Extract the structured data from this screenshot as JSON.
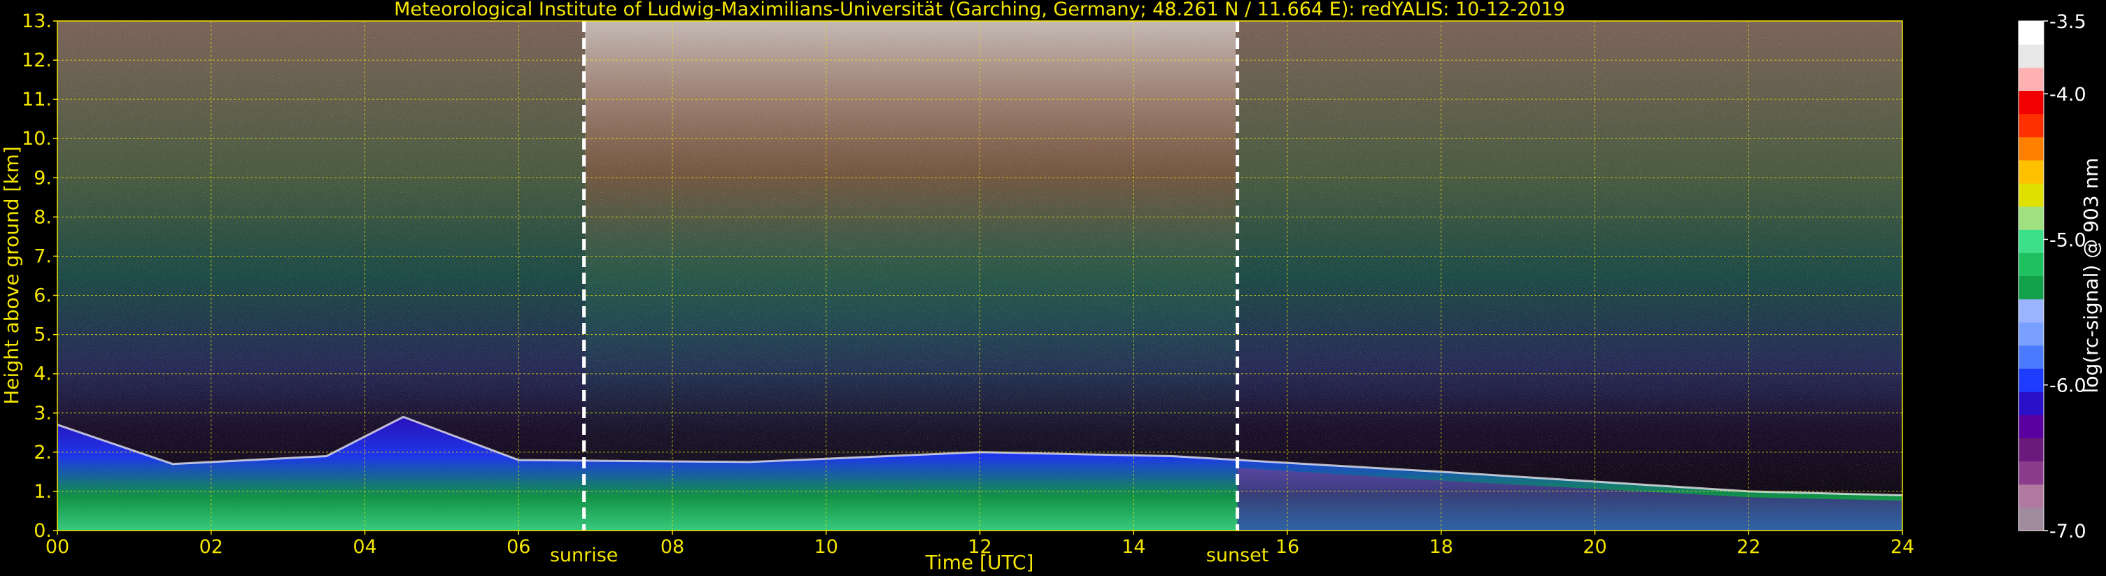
{
  "chart_data": {
    "type": "heatmap",
    "title": "Meteorological Institute of Ludwig-Maximilians-Universität (Garching, Germany; 48.261 N / 11.664 E):    redYALIS: 10-12-2019",
    "xlabel": "Time [UTC]",
    "ylabel": "Height above ground [km]",
    "xlim": [
      0,
      24
    ],
    "ylim": [
      0,
      13
    ],
    "x_ticks": [
      "00",
      "02",
      "04",
      "06",
      "08",
      "10",
      "12",
      "14",
      "16",
      "18",
      "20",
      "22",
      "24"
    ],
    "y_ticks": [
      "0.",
      "1.",
      "2.",
      "3.",
      "4.",
      "5.",
      "6.",
      "7.",
      "8.",
      "9.",
      "10.",
      "11.",
      "12.",
      "13."
    ],
    "grid": true,
    "annotations": [
      {
        "label": "sunrise",
        "x": 6.85
      },
      {
        "label": "sunset",
        "x": 15.35
      }
    ],
    "colorbar": {
      "label": "log(rc-signal) @ 903 nm",
      "ticks": [
        "-3.5",
        "-4.0",
        "-5.0",
        "-6.0",
        "-7.0"
      ],
      "range": [
        -7.0,
        -3.5
      ],
      "colors": [
        "#a08a9e",
        "#b07aa0",
        "#8c3c8c",
        "#6a1a7a",
        "#5a00a0",
        "#2a10c8",
        "#1e3cff",
        "#4a7aff",
        "#7aa0ff",
        "#9ab4ff",
        "#12a04a",
        "#1ec060",
        "#3ce08a",
        "#a0e080",
        "#e0e000",
        "#ffc000",
        "#ff8000",
        "#ff3000",
        "#f00000",
        "#ffb0b0",
        "#e8e8e8",
        "#ffffff"
      ]
    },
    "boundary_layer_top_km": [
      {
        "time": 0.0,
        "height": 2.7
      },
      {
        "time": 1.5,
        "height": 1.7
      },
      {
        "time": 3.5,
        "height": 1.9
      },
      {
        "time": 4.5,
        "height": 2.9
      },
      {
        "time": 6.0,
        "height": 1.8
      },
      {
        "time": 9.0,
        "height": 1.75
      },
      {
        "time": 12.0,
        "height": 2.0
      },
      {
        "time": 14.5,
        "height": 1.9
      },
      {
        "time": 18.0,
        "height": 1.5
      },
      {
        "time": 22.0,
        "height": 1.0
      },
      {
        "time": 24.0,
        "height": 0.9
      }
    ]
  }
}
